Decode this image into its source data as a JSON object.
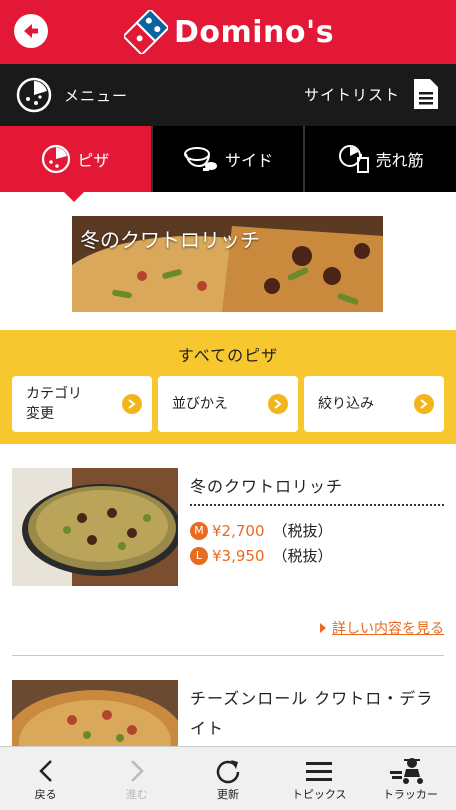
{
  "header": {
    "brand": "Domino's",
    "brand_color": "#e31837",
    "back_icon": "arrow-left-icon"
  },
  "subnav": {
    "menu_label": "メニュー",
    "sitelist_label": "サイトリスト"
  },
  "tabs": [
    {
      "label": "ピザ",
      "icon": "pizza-icon",
      "active": true
    },
    {
      "label": "サイド",
      "icon": "side-dish-icon",
      "active": false
    },
    {
      "label": "売れ筋",
      "icon": "bestseller-icon",
      "active": false
    }
  ],
  "banner": {
    "title": "冬のクワトロリッチ"
  },
  "filter": {
    "title": "すべてのピザ",
    "buttons": [
      {
        "label": "カテゴリ\n変更"
      },
      {
        "label": "並びかえ"
      },
      {
        "label": "絞り込み"
      }
    ],
    "accent": "#f7c72f"
  },
  "products": [
    {
      "name": "冬のクワトロリッチ",
      "prices": [
        {
          "size": "M",
          "price": "¥2,700",
          "tax": "（税抜）"
        },
        {
          "size": "L",
          "price": "¥3,950",
          "tax": "（税抜）"
        }
      ],
      "detail_link": "詳しい内容を見る"
    },
    {
      "name": "チーズンロール クワトロ・デライト"
    }
  ],
  "toolbar": [
    {
      "label": "戻る",
      "icon": "chevron-left-icon",
      "enabled": true
    },
    {
      "label": "進む",
      "icon": "chevron-right-icon",
      "enabled": false
    },
    {
      "label": "更新",
      "icon": "refresh-icon",
      "enabled": true
    },
    {
      "label": "トピックス",
      "icon": "menu-lines-icon",
      "enabled": true
    },
    {
      "label": "トラッカー",
      "icon": "delivery-tracker-icon",
      "enabled": true
    }
  ]
}
